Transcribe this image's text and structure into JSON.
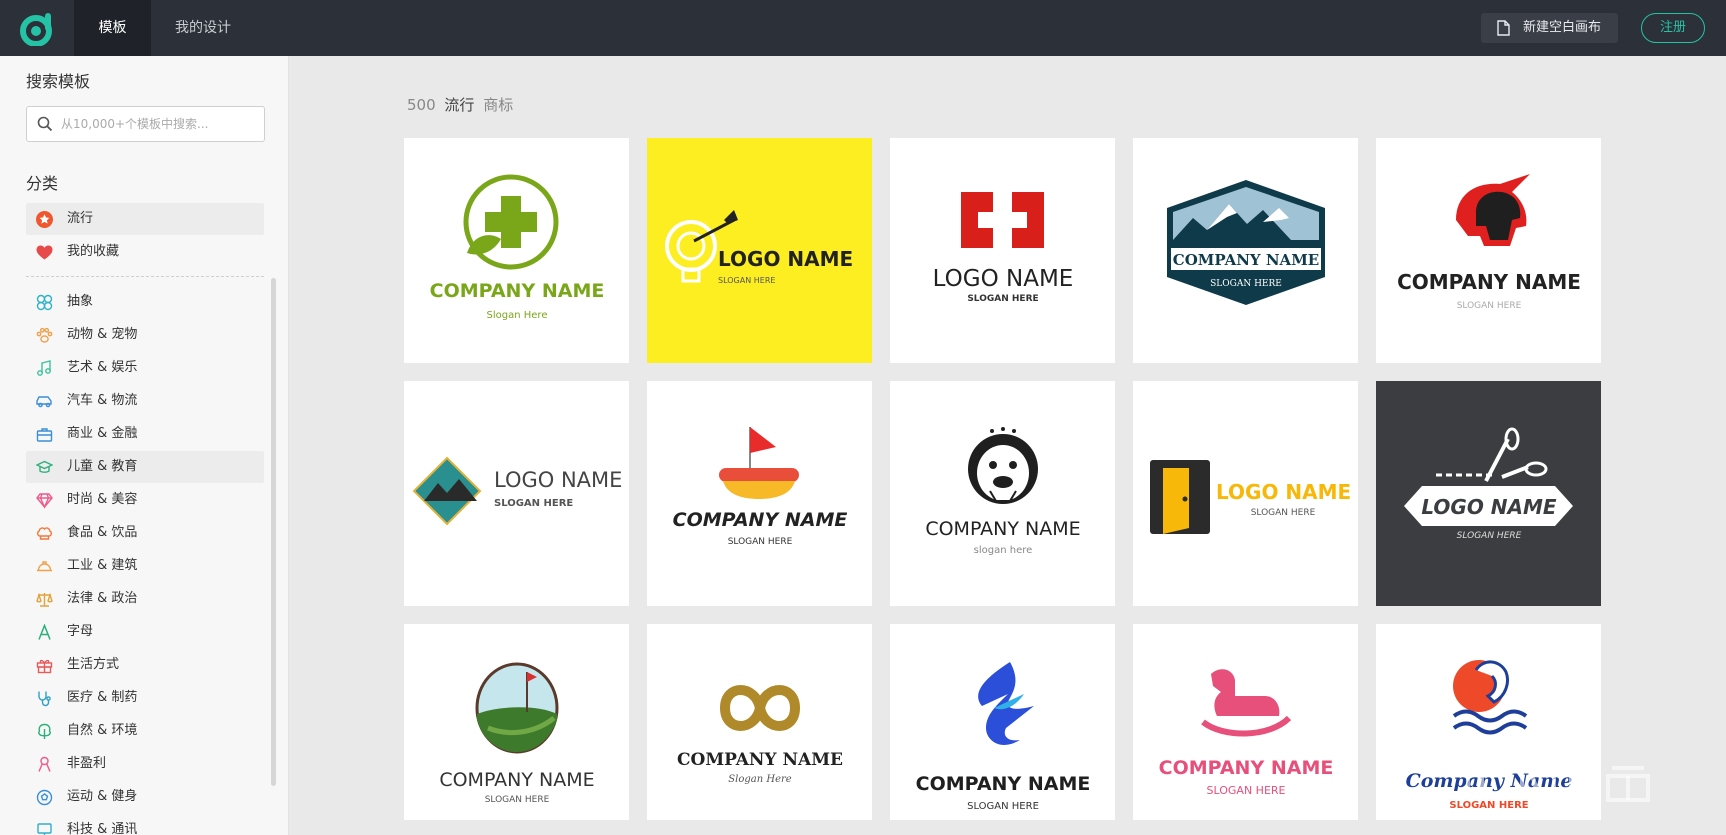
{
  "nav": {
    "tabs": [
      "模板",
      "我的设计"
    ],
    "new_canvas": "新建空白画布",
    "register": "注册"
  },
  "sidebar": {
    "search_title": "搜索模板",
    "search_placeholder": "从10,000+个模板中搜索...",
    "category_title": "分类",
    "top_items": [
      {
        "label": "流行",
        "icon": "star-icon"
      },
      {
        "label": "我的收藏",
        "icon": "heart-icon"
      }
    ],
    "categories": [
      {
        "label": "抽象",
        "icon": "abstract-icon"
      },
      {
        "label": "动物 & 宠物",
        "icon": "paw-icon"
      },
      {
        "label": "艺术 & 娱乐",
        "icon": "music-note-icon"
      },
      {
        "label": "汽车 & 物流",
        "icon": "car-icon"
      },
      {
        "label": "商业 & 金融",
        "icon": "briefcase-icon"
      },
      {
        "label": "儿童 & 教育",
        "icon": "graduation-cap-icon"
      },
      {
        "label": "时尚 & 美容",
        "icon": "diamond-icon"
      },
      {
        "label": "食品 & 饮品",
        "icon": "chef-hat-icon"
      },
      {
        "label": "工业 & 建筑",
        "icon": "hard-hat-icon"
      },
      {
        "label": "法律 & 政治",
        "icon": "scales-icon"
      },
      {
        "label": "字母",
        "icon": "letter-a-icon"
      },
      {
        "label": "生活方式",
        "icon": "gift-icon"
      },
      {
        "label": "医疗 & 制药",
        "icon": "stethoscope-icon"
      },
      {
        "label": "自然 & 环境",
        "icon": "tree-icon"
      },
      {
        "label": "非盈利",
        "icon": "ribbon-icon"
      },
      {
        "label": "运动 & 健身",
        "icon": "soccer-ball-icon"
      },
      {
        "label": "科技 & 通讯",
        "icon": "tech-icon"
      }
    ]
  },
  "main": {
    "count": "500",
    "sort": "流行",
    "type": "商标",
    "templates": [
      {
        "title": "COMPANY NAME",
        "slogan": "Slogan Here"
      },
      {
        "title": "LOGO NAME",
        "slogan": "SLOGAN HERE"
      },
      {
        "title": "LOGO NAME",
        "slogan": "SLOGAN HERE"
      },
      {
        "title": "COMPANY NAME",
        "slogan": "SLOGAN HERE"
      },
      {
        "title": "COMPANY NAME",
        "slogan": "SLOGAN HERE"
      },
      {
        "title": "LOGO NAME",
        "slogan": "SLOGAN HERE"
      },
      {
        "title": "COMPANY NAME",
        "slogan": "SLOGAN HERE"
      },
      {
        "title": "COMPANY NAME",
        "slogan": "slogan here"
      },
      {
        "title": "LOGO NAME",
        "slogan": "SLOGAN HERE"
      },
      {
        "title": "LOGO NAME",
        "slogan": "SLOGAN HERE"
      },
      {
        "title": "COMPANY NAME",
        "slogan": "SLOGAN HERE"
      },
      {
        "title": "COMPANY NAME",
        "slogan": "Slogan Here"
      },
      {
        "title": "COMPANY NAME",
        "slogan": "SLOGAN HERE"
      },
      {
        "title": "COMPANY NAME",
        "slogan": "SLOGAN HERE"
      },
      {
        "title": "Company Name",
        "slogan": "SLOGAN HERE"
      }
    ]
  },
  "colors": {
    "topbar": "#2c3038",
    "accent": "#25c3a6",
    "yellow_card": "#fcee21",
    "dark_card": "#3b3d40"
  }
}
